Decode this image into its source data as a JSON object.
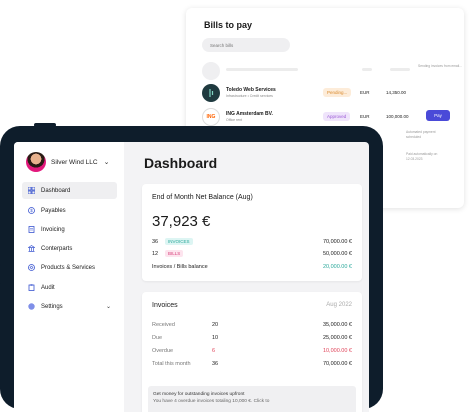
{
  "bills": {
    "title": "Bills to pay",
    "search_placeholder": "Search bills",
    "rows": [
      {
        "name": "Toledo Web Services",
        "sub": "Infrastructure • Credit services",
        "status": "Pending...",
        "currency": "EUR",
        "amount": "14,350.00",
        "note": "Sending invoices from email...",
        "avatar_color": "#1f3a3f"
      },
      {
        "name": "ING Amsterdam BV.",
        "sub": "Office rent",
        "status": "Approved",
        "currency": "EUR",
        "amount": "100,000.00",
        "button": "Pay",
        "avatar_label": "ING"
      }
    ],
    "notes": [
      "Automated payment scheduled",
      "Paid automatically on 12.03.2023"
    ]
  },
  "sidebar": {
    "company": "Silver Wind LLC",
    "items": [
      {
        "label": "Dashboard",
        "icon": "grid-icon"
      },
      {
        "label": "Payables",
        "icon": "dollar-icon"
      },
      {
        "label": "Invoicing",
        "icon": "document-icon"
      },
      {
        "label": "Conterparts",
        "icon": "bank-icon"
      },
      {
        "label": "Products & Services",
        "icon": "box-icon"
      },
      {
        "label": "Audit",
        "icon": "audit-icon"
      },
      {
        "label": "Settings",
        "icon": "settings-icon"
      }
    ]
  },
  "main": {
    "title": "Dashboard",
    "balance": {
      "title": "End of Month Net Balance (Aug)",
      "amount": "37,923 €",
      "invoices_count": "36",
      "invoices_tag": "INVOICES",
      "invoices_amount": "70,000.00 €",
      "bills_count": "12",
      "bills_tag": "BILLS",
      "bills_amount": "50,000.00 €",
      "ratio_label": "Invoices / Bills balance",
      "ratio_amount": "20,000.00 €"
    },
    "invoices": {
      "title": "Invoices",
      "period": "Aug 2022",
      "rows": [
        {
          "label": "Received",
          "count": "20",
          "amount": "35,000.00 €"
        },
        {
          "label": "Due",
          "count": "10",
          "amount": "25,000.00 €"
        },
        {
          "label": "Overdue",
          "count": "6",
          "amount": "10,000.00 €"
        },
        {
          "label": "Total this month",
          "count": "36",
          "amount": "70,000.00 €"
        }
      ],
      "banner_title": "Get money for outstanding invoices upfront",
      "banner_text": "You have 4 overdue invoices totaling 10,000 €. Click to"
    }
  },
  "colors": {
    "accent": "#4a4ad8",
    "tablet": "#0e1d2b",
    "pending_bg": "#fdecd9",
    "pending_fg": "#d98a2c",
    "approved_bg": "#efe4fb",
    "approved_fg": "#9b59d6",
    "invoices_tag_bg": "#ddf5f3",
    "invoices_tag_fg": "#2aa89a",
    "bills_tag_bg": "#fde4ee",
    "bills_tag_fg": "#d63f7a",
    "positive": "#2aa89a",
    "overdue": "#e0445a"
  }
}
